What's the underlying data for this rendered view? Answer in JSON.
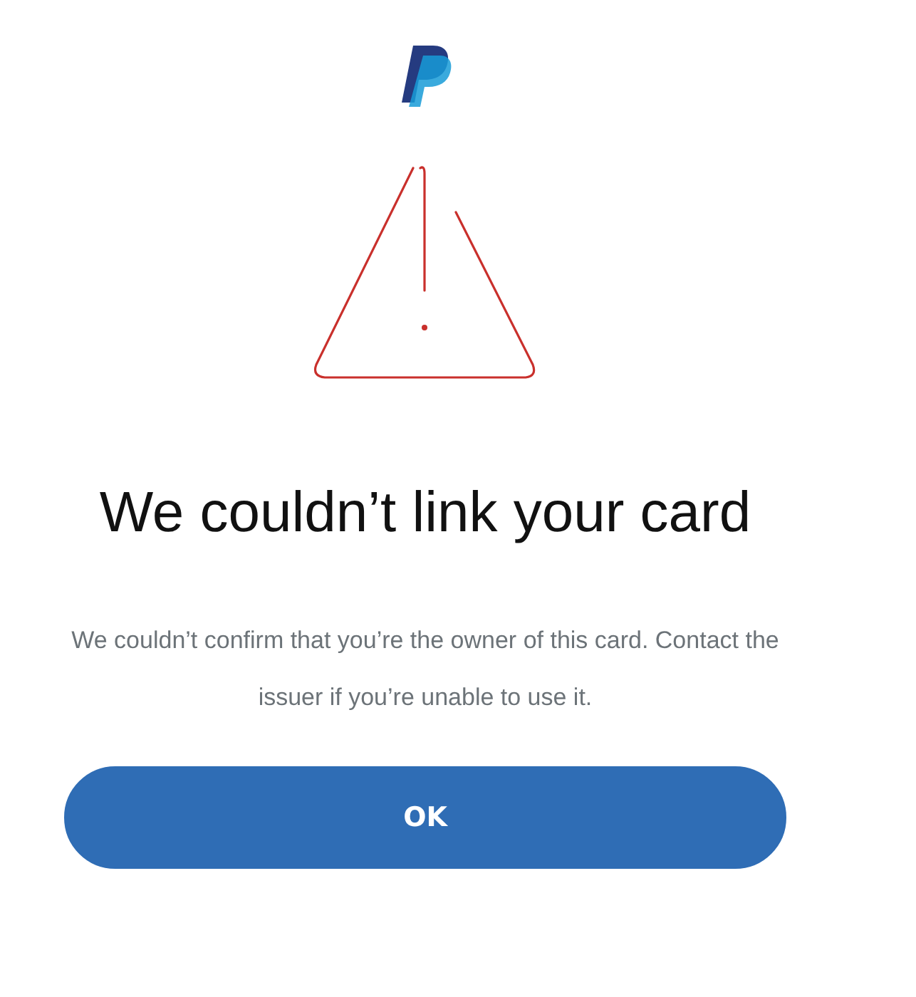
{
  "title": "We couldn’t link your card",
  "message": "We couldn’t confirm that you’re the owner of this card. Contact the issuer if you’re unable to use it.",
  "buttons": [
    {
      "label": "OK",
      "kind": "primary"
    }
  ]
}
